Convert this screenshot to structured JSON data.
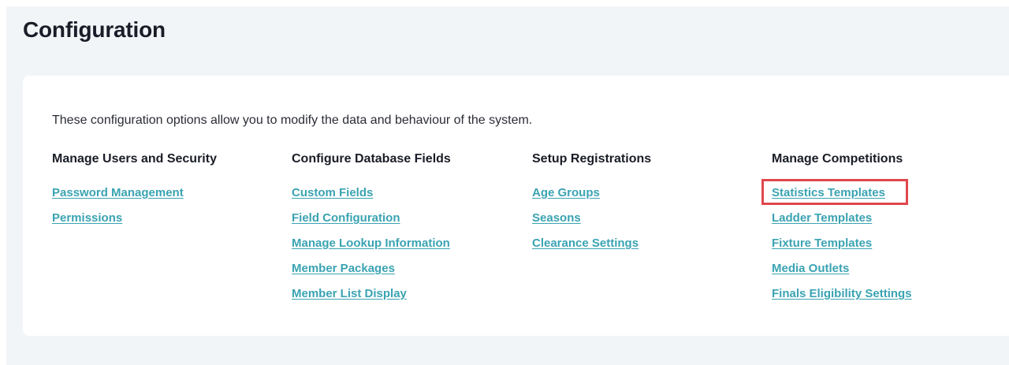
{
  "page": {
    "title": "Configuration"
  },
  "panel": {
    "intro": "These configuration options allow you to modify the data and behaviour of the system."
  },
  "columns": [
    {
      "heading": "Manage Users and Security",
      "links": [
        "Password Management",
        "Permissions"
      ]
    },
    {
      "heading": "Configure Database Fields",
      "links": [
        "Custom Fields",
        "Field Configuration",
        "Manage Lookup Information",
        "Member Packages",
        "Member List Display"
      ]
    },
    {
      "heading": "Setup Registrations",
      "links": [
        "Age Groups",
        "Seasons",
        "Clearance Settings"
      ]
    },
    {
      "heading": "Manage Competitions",
      "links": [
        "Statistics Templates",
        "Ladder Templates",
        "Fixture Templates",
        "Media Outlets",
        "Finals Eligibility Settings"
      ]
    }
  ],
  "highlight": {
    "target": "Statistics Templates",
    "color": "#e0474c"
  },
  "colors": {
    "link": "#3aa3b2",
    "page_background": "#f2f5f8",
    "heading": "#1a1d27"
  }
}
